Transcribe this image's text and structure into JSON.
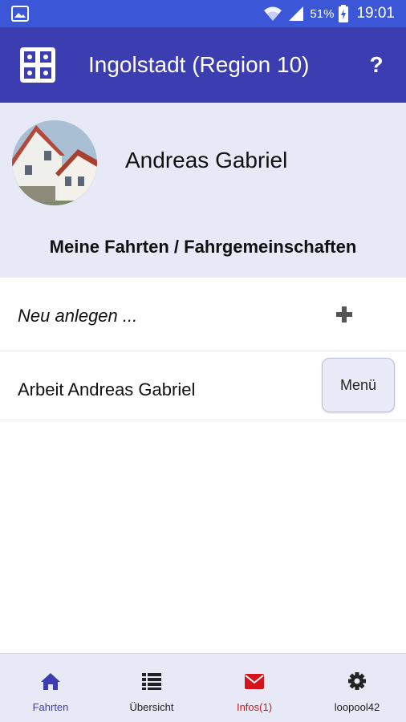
{
  "statusbar": {
    "battery_percent": "51%",
    "time": "19:01",
    "icons": [
      "image-notification-icon",
      "wifi-icon",
      "signal-icon",
      "battery-charging-icon"
    ]
  },
  "appbar": {
    "title": "Ingolstadt (Region 10)",
    "help_label": "?",
    "color": "#3b3db0"
  },
  "profile": {
    "name": "Andreas Gabriel",
    "section_title": "Meine Fahrten / Fahrgemeinschaften"
  },
  "list": {
    "new_label": "Neu anlegen ...",
    "items": [
      {
        "label": "Arbeit Andreas Gabriel",
        "menu_label": "Menü"
      }
    ]
  },
  "bottomnav": {
    "items": [
      {
        "label": "Fahrten",
        "icon": "home-icon",
        "active": true
      },
      {
        "label": "Übersicht",
        "icon": "list-icon"
      },
      {
        "label": "Infos(1)",
        "icon": "mail-icon",
        "alert": true
      },
      {
        "label": "loopool42",
        "icon": "gear-icon"
      }
    ]
  },
  "colors": {
    "statusbar": "#3b57d8",
    "appbar": "#3b3db0",
    "profile_bg": "#e7e9f7",
    "alert": "#d4141c"
  }
}
